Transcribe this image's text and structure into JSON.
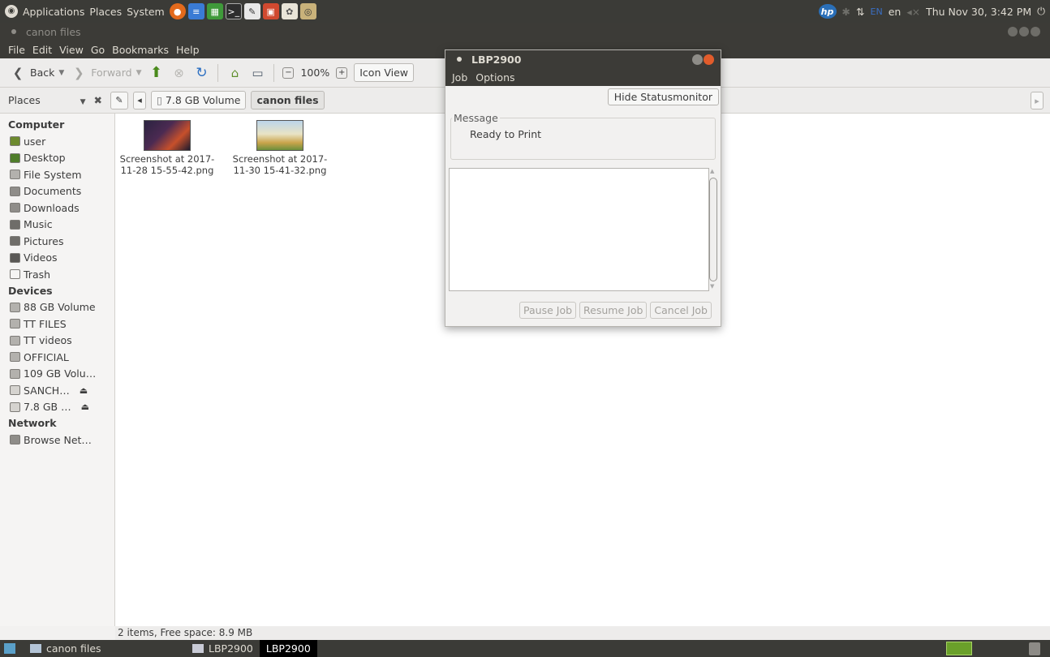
{
  "top_panel": {
    "menus": [
      "Applications",
      "Places",
      "System"
    ],
    "keyboard_layout": "EN",
    "language": "en",
    "volume": "◂×",
    "clock": "Thu Nov 30,  3:42 PM"
  },
  "window": {
    "title": "canon files",
    "menu": [
      "File",
      "Edit",
      "View",
      "Go",
      "Bookmarks",
      "Help"
    ]
  },
  "toolbar": {
    "back_label": "Back",
    "forward_label": "Forward",
    "zoom_level": "100%",
    "view_mode": "Icon View"
  },
  "location": {
    "places_label": "Places",
    "crumbs": [
      "7.8 GB Volume",
      "canon files"
    ]
  },
  "sidebar": {
    "sections": [
      {
        "header": "Computer",
        "items": [
          {
            "label": "user",
            "icon": "home-icon",
            "color": "#6d8a2e"
          },
          {
            "label": "Desktop",
            "icon": "desktop-icon",
            "color": "#4f7d2a"
          },
          {
            "label": "File System",
            "icon": "drive-icon",
            "color": "#b3b1ad"
          },
          {
            "label": "Documents",
            "icon": "folder-icon",
            "color": "#8f8d89"
          },
          {
            "label": "Downloads",
            "icon": "folder-icon",
            "color": "#8f8d89"
          },
          {
            "label": "Music",
            "icon": "music-icon",
            "color": "#6f6d69"
          },
          {
            "label": "Pictures",
            "icon": "pictures-icon",
            "color": "#6f6d69"
          },
          {
            "label": "Videos",
            "icon": "videos-icon",
            "color": "#5a5855"
          },
          {
            "label": "Trash",
            "icon": "trash-icon",
            "color": "#f5f4f3"
          }
        ]
      },
      {
        "header": "Devices",
        "items": [
          {
            "label": "88 GB Volume",
            "icon": "drive-icon",
            "color": "#b3b1ad"
          },
          {
            "label": "TT FILES",
            "icon": "drive-icon",
            "color": "#b3b1ad"
          },
          {
            "label": "TT videos",
            "icon": "drive-icon",
            "color": "#b3b1ad"
          },
          {
            "label": "OFFICIAL",
            "icon": "drive-icon",
            "color": "#b3b1ad"
          },
          {
            "label": "109 GB Volu…",
            "icon": "drive-icon",
            "color": "#b3b1ad"
          },
          {
            "label": "SANCH…",
            "icon": "disc-icon",
            "color": "#d5d3cf",
            "eject": "⏏"
          },
          {
            "label": "7.8 GB …",
            "icon": "usb-icon",
            "color": "#d5d3cf",
            "eject": "⏏"
          }
        ]
      },
      {
        "header": "Network",
        "items": [
          {
            "label": "Browse Net…",
            "icon": "network-icon",
            "color": "#8f8d89"
          }
        ]
      }
    ]
  },
  "files": [
    {
      "name_line1": "Screenshot at 2017-",
      "name_line2": "11-28 15-55-42.png"
    },
    {
      "name_line1": "Screenshot at 2017-",
      "name_line2": "11-30 15-41-32.png"
    }
  ],
  "statusbar": {
    "text": "2 items, Free space: 8.9 MB"
  },
  "dialog": {
    "title": "LBP2900",
    "menu": [
      "Job",
      "Options"
    ],
    "hide_button": "Hide Statusmonitor",
    "message_label": "Message",
    "message_text": "Ready to Print",
    "buttons": [
      "Pause Job",
      "Resume Job",
      "Cancel Job"
    ]
  },
  "taskbar": {
    "tasks": [
      "canon files",
      "LBP2900",
      "LBP2900"
    ]
  }
}
